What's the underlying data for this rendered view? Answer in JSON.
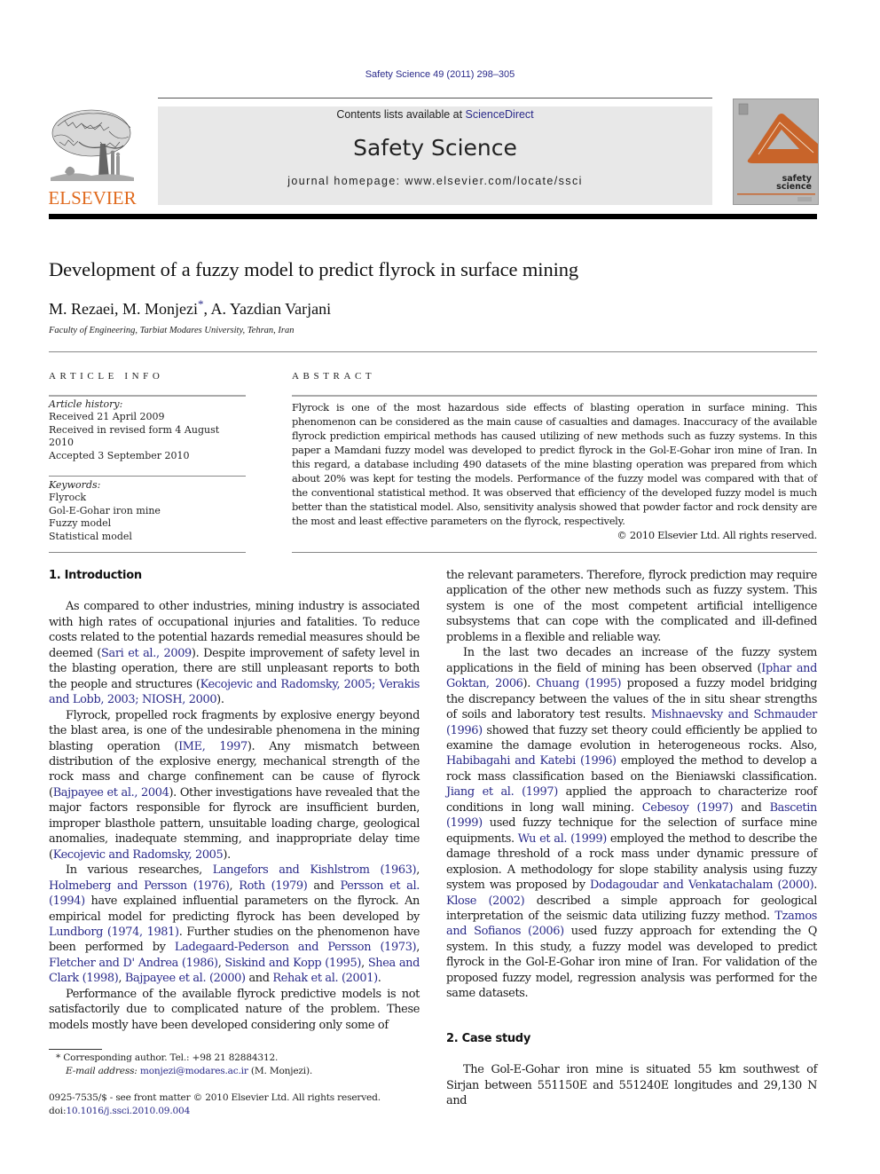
{
  "header": {
    "citation": "Safety Science 49 (2011) 298–305",
    "contents_prefix": "Contents lists available at ",
    "contents_link": "ScienceDirect",
    "journal_title": "Safety Science",
    "homepage": "journal homepage: www.elsevier.com/locate/ssci",
    "publisher_logo_text": "ELSEVIER",
    "cover_text_line1": "safety",
    "cover_text_line2": "science",
    "colors": {
      "publisher_orange": "#e06a1e",
      "link_blue": "#2a2a8a",
      "cover_orange": "#c8642a",
      "banner_gray": "#e8e8e8"
    }
  },
  "article": {
    "title": "Development of a fuzzy model to predict flyrock in surface mining",
    "authors": [
      {
        "name": "M. Rezaei",
        "sep": ", "
      },
      {
        "name": "M. Monjezi",
        "mark": "*",
        "sep": ", "
      },
      {
        "name": "A. Yazdian Varjani",
        "sep": ""
      }
    ],
    "affiliation": "Faculty of Engineering, Tarbiat Modares University, Tehran, Iran"
  },
  "article_info": {
    "heading": "ARTICLE INFO",
    "history_label": "Article history:",
    "history": [
      "Received 21 April 2009",
      "Received in revised form 4 August 2010",
      "Accepted 3 September 2010"
    ],
    "keywords_label": "Keywords:",
    "keywords": [
      "Flyrock",
      "Gol-E-Gohar iron mine",
      "Fuzzy model",
      "Statistical model"
    ]
  },
  "abstract": {
    "heading": "ABSTRACT",
    "text": "Flyrock is one of the most hazardous side effects of blasting operation in surface mining. This phenomenon can be considered as the main cause of casualties and damages. Inaccuracy of the available flyrock prediction empirical methods has caused utilizing of new methods such as fuzzy systems. In this paper a Mamdani fuzzy model was developed to predict flyrock in the Gol-E-Gohar iron mine of Iran. In this regard, a database including 490 datasets of the mine blasting operation was prepared from which about 20% was kept for testing the models. Performance of the fuzzy model was compared with that of the conventional statistical method. It was observed that efficiency of the developed fuzzy model is much better than the statistical model. Also, sensitivity analysis showed that powder factor and rock density are the most and least effective parameters on the flyrock, respectively.",
    "copyright": "© 2010 Elsevier Ltd. All rights reserved."
  },
  "body": {
    "sec1_heading": "1. Introduction",
    "p1": [
      {
        "t": "As compared to other industries, mining industry is associated with high rates of occupational injuries and fatalities. To reduce costs related to the potential hazards remedial measures should be deemed ("
      },
      {
        "l": "Sari et al., 2009"
      },
      {
        "t": "). Despite improvement of safety level in the blasting operation, there are still unpleasant reports to both the people and structures ("
      },
      {
        "l": "Kecojevic and Radomsky, 2005; Verakis and Lobb, 2003; NIOSH, 2000"
      },
      {
        "t": ")."
      }
    ],
    "p2": [
      {
        "t": "Flyrock, propelled rock fragments by explosive energy beyond the blast area, is one of the undesirable phenomena in the mining blasting operation ("
      },
      {
        "l": "IME, 1997"
      },
      {
        "t": "). Any mismatch between distribution of the explosive energy, mechanical strength of the rock mass and charge confinement can be cause of flyrock ("
      },
      {
        "l": "Bajpayee et al., 2004"
      },
      {
        "t": "). Other investigations have revealed that the major factors responsible for flyrock are insufficient burden, improper blasthole pattern, unsuitable loading charge, geological anomalies, inadequate stemming, and inappropriate delay time ("
      },
      {
        "l": "Kecojevic and Radomsky, 2005"
      },
      {
        "t": ")."
      }
    ],
    "p3": [
      {
        "t": "In various researches, "
      },
      {
        "l": "Langefors and Kishlstrom (1963)"
      },
      {
        "t": ", "
      },
      {
        "l": "Holmeberg and Persson (1976)"
      },
      {
        "t": ", "
      },
      {
        "l": "Roth (1979)"
      },
      {
        "t": " and "
      },
      {
        "l": "Persson et al. (1994)"
      },
      {
        "t": " have explained influential parameters on the flyrock. An empirical model for predicting flyrock has been developed by "
      },
      {
        "l": "Lundborg (1974, 1981)"
      },
      {
        "t": ". Further studies on the phenomenon have been performed by "
      },
      {
        "l": "Ladegaard-Pederson and Persson (1973)"
      },
      {
        "t": ", "
      },
      {
        "l": "Fletcher and D' Andrea (1986)"
      },
      {
        "t": ", "
      },
      {
        "l": "Siskind and Kopp (1995)"
      },
      {
        "t": ", "
      },
      {
        "l": "Shea and Clark (1998)"
      },
      {
        "t": ", "
      },
      {
        "l": "Bajpayee et al. (2000)"
      },
      {
        "t": " and "
      },
      {
        "l": "Rehak et al. (2001)"
      },
      {
        "t": "."
      }
    ],
    "p4": [
      {
        "t": "Performance of the available flyrock predictive models is not satisfactorily due to complicated nature of the problem. These models mostly have been developed considering only some of"
      }
    ],
    "p5": [
      {
        "t": "the relevant parameters. Therefore, flyrock prediction may require application of the other new methods such as fuzzy system. This system is one of the most competent artificial intelligence subsystems that can cope with the complicated and ill-defined problems in a flexible and reliable way."
      }
    ],
    "p6": [
      {
        "t": "In the last two decades an increase of the fuzzy system applications in the field of mining has been observed ("
      },
      {
        "l": "Iphar and Goktan, 2006"
      },
      {
        "t": "). "
      },
      {
        "l": "Chuang (1995)"
      },
      {
        "t": " proposed a fuzzy model bridging the discrepancy between the values of the in situ shear strengths of soils and laboratory test results. "
      },
      {
        "l": "Mishnaevsky and Schmauder (1996)"
      },
      {
        "t": " showed that fuzzy set theory could efficiently be applied to examine the damage evolution in heterogeneous rocks. Also, "
      },
      {
        "l": "Habibagahi and Katebi (1996)"
      },
      {
        "t": " employed the method to develop a rock mass classification based on the Bieniawski classification. "
      },
      {
        "l": "Jiang et al. (1997)"
      },
      {
        "t": " applied the approach to characterize roof conditions in long wall mining. "
      },
      {
        "l": "Cebesoy (1997)"
      },
      {
        "t": " and "
      },
      {
        "l": "Bascetin (1999)"
      },
      {
        "t": " used fuzzy technique for the selection of surface mine equipments. "
      },
      {
        "l": "Wu et al. (1999)"
      },
      {
        "t": " employed the method to describe the damage threshold of a rock mass under dynamic pressure of explosion. A methodology for slope stability analysis using fuzzy system was proposed by "
      },
      {
        "l": "Dodagoudar and Venkatachalam (2000)"
      },
      {
        "t": ". "
      },
      {
        "l": "Klose (2002)"
      },
      {
        "t": " described a simple approach for geological interpretation of the seismic data utilizing fuzzy method. "
      },
      {
        "l": "Tzamos and Sofianos (2006)"
      },
      {
        "t": " used fuzzy approach for extending the Q system. In this study, a fuzzy model was developed to predict flyrock in the Gol-E-Gohar iron mine of Iran. For validation of the proposed fuzzy model, regression analysis was performed for the same datasets."
      }
    ],
    "sec2_heading": "2. Case study",
    "p7": [
      {
        "t": "The Gol-E-Gohar iron mine is situated 55 km southwest of Sirjan between 551150E and 551240E longitudes and 29,130 N and"
      }
    ]
  },
  "footnotes": {
    "corresponding_mark": "*",
    "corresponding": "Corresponding author. Tel.: +98 21 82884312.",
    "email_label": "E-mail address:",
    "email": "monjezi@modares.ac.ir",
    "email_suffix": " (M. Monjezi).",
    "issn": "0925-7535/$ - see front matter © 2010 Elsevier Ltd. All rights reserved.",
    "doi_prefix": "doi:",
    "doi": "10.1016/j.ssci.2010.09.004"
  }
}
